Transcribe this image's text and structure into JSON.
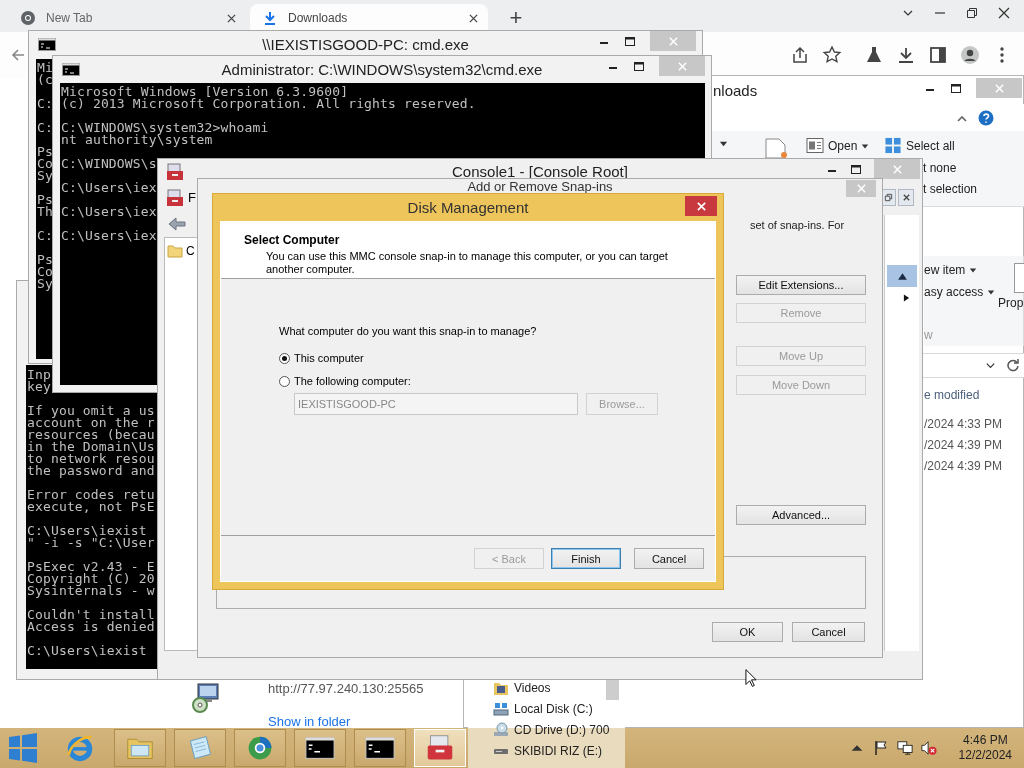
{
  "browser": {
    "tabs": [
      {
        "label": "New Tab",
        "selected": false,
        "kind": "newtab"
      },
      {
        "label": "Downloads",
        "selected": true,
        "kind": "download"
      }
    ],
    "new_tab_button": "+",
    "download": {
      "url": "http://77.97.240.130:25565",
      "link": "Show in folder"
    }
  },
  "explorer": {
    "title": "nloads",
    "ribbon": [
      {
        "label": "Open",
        "dropdown": true,
        "kind": "open"
      },
      {
        "label": "Select all",
        "dropdown": false,
        "kind": "select"
      },
      {
        "label": "t none",
        "dropdown": false,
        "kind": "plain"
      },
      {
        "label": "t selection",
        "dropdown": false,
        "kind": "plain"
      }
    ],
    "ribbon_right": [
      {
        "label": "ew item",
        "dropdown": true
      },
      {
        "label": "asy access",
        "dropdown": true
      }
    ],
    "properties": "Prop",
    "group_label": "w",
    "column": "e modified",
    "dates": [
      "/2024 4:33 PM",
      "/2024 4:39 PM",
      "/2024 4:39 PM"
    ],
    "nav": [
      {
        "label": "Videos",
        "kind": "videos"
      },
      {
        "label": "Local Disk (C:)",
        "kind": "disk"
      },
      {
        "label": "CD Drive (D:) 700",
        "kind": "cd"
      },
      {
        "label": "SKIBIDI RIZ (E:)",
        "kind": "usb"
      }
    ]
  },
  "cmd_back": {
    "blocks": [
      [
        "Inp",
        "key"
      ],
      [
        "If you omit a us",
        "account on the r",
        "resources (becau",
        "in the Domain\\Us",
        "to network resou",
        "the password and"
      ],
      [
        "Error codes retu",
        "execute, not PsE"
      ],
      [
        "C:\\Users\\iexist",
        "\" -i -s \"C:\\User"
      ],
      [
        "PsExec v2.43 - E",
        "Copyright (C) 20",
        "Sysinternals - w"
      ],
      [
        "Couldn't install",
        "Access is denied"
      ],
      [
        "C:\\Users\\iexist"
      ]
    ]
  },
  "cmd_remote": {
    "title": "\\\\IEXISTISGOOD-PC: cmd.exe",
    "blocks": [
      [
        "Mi",
        "(c"
      ],
      [
        "C:"
      ],
      [
        "C:"
      ],
      [
        "Ps",
        "Co",
        "Sy"
      ],
      [
        "Ps",
        "Th"
      ],
      [
        "C:"
      ],
      [
        "Ps",
        "Co",
        "Sy"
      ]
    ]
  },
  "cmd_admin": {
    "title": "Administrator: C:\\WINDOWS\\system32\\cmd.exe",
    "blocks": [
      [
        "Microsoft Windows [Version 6.3.9600]",
        "(c) 2013 Microsoft Corporation. All rights reserved."
      ],
      [
        "C:\\WINDOWS\\system32>whoami",
        "nt authority\\system"
      ],
      [
        "C:\\WINDOWS\\s"
      ],
      [
        "C:\\Users\\iex"
      ],
      [
        "C:\\Users\\iex"
      ],
      [
        "C:\\Users\\iex"
      ]
    ]
  },
  "mmc": {
    "title": "Console1 - [Console Root]",
    "menu": [
      "F"
    ],
    "tree": [
      "C"
    ]
  },
  "snapins": {
    "title": "Add or Remove Snap-ins",
    "intro": "set of snap-ins. For",
    "buttons": [
      {
        "label": "Edit Extensions...",
        "disabled": false
      },
      {
        "label": "Remove",
        "disabled": true
      },
      {
        "label": "Move Up",
        "disabled": true
      },
      {
        "label": "Move Down",
        "disabled": true
      },
      {
        "label": "Advanced...",
        "disabled": false
      }
    ],
    "ok": "OK",
    "cancel": "Cancel"
  },
  "disk": {
    "title": "Disk Management",
    "heading": "Select Computer",
    "description": "You can use this MMC console snap-in to manage this computer, or you can target another computer.",
    "question": "What computer do you want this snap-in to manage?",
    "options": [
      {
        "label": "This computer",
        "selected": true
      },
      {
        "label": "The following computer:",
        "selected": false
      }
    ],
    "computer": {
      "value": "IEXISTISGOOD-PC",
      "disabled": true
    },
    "browse": {
      "label": "Browse...",
      "disabled": true
    },
    "buttons": [
      {
        "label": "< Back",
        "disabled": true,
        "default": false
      },
      {
        "label": "Finish",
        "disabled": false,
        "default": true
      },
      {
        "label": "Cancel",
        "disabled": false,
        "default": false
      }
    ]
  },
  "taskbar": {
    "apps": [
      {
        "kind": "ie",
        "selected": false
      },
      {
        "kind": "folder",
        "selected": false
      },
      {
        "kind": "notepad",
        "selected": false
      },
      {
        "kind": "globe",
        "selected": false
      },
      {
        "kind": "cmd",
        "selected": false
      },
      {
        "kind": "cmd",
        "selected": false
      },
      {
        "kind": "mmc",
        "selected": true
      }
    ],
    "volume_muted": true,
    "time": "4:46 PM",
    "date": "12/2/2024"
  }
}
